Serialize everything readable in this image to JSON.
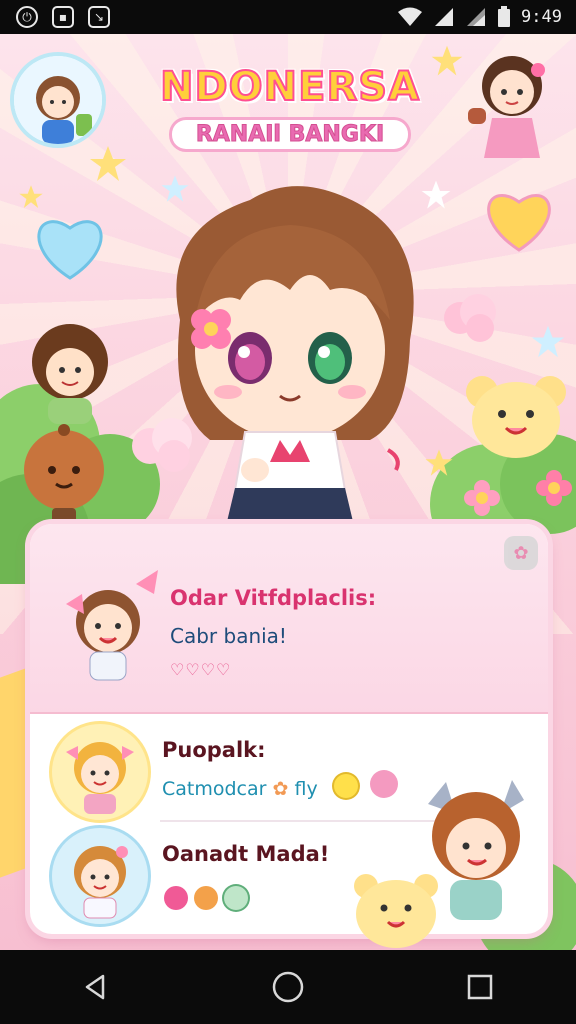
{
  "status_bar": {
    "time": "9:49",
    "left_icons": [
      "alarm-icon",
      "image-icon",
      "download-icon"
    ],
    "right_icons": [
      "wifi-icon",
      "signal-icon",
      "signal-icon",
      "battery-icon"
    ]
  },
  "header": {
    "title": "NDONERSA",
    "subtitle": "RANAIl BANGKI"
  },
  "featured": {
    "title": "Odar Vitfdplaclis:",
    "subtitle": "Cabr bania!",
    "hearts": "♡♡♡♡"
  },
  "list": [
    {
      "title": "Puopalk:",
      "subtitle": "Catmodcar",
      "extra": "fly"
    },
    {
      "title": "Oanadt Mada!",
      "subtitle": "",
      "extra": ""
    }
  ],
  "colors": {
    "accent_pink": "#e8568d",
    "title_yellow": "#ffcf3a",
    "panel_bg": "#ffffff"
  },
  "nav": [
    "back-icon",
    "home-icon",
    "recents-icon"
  ]
}
